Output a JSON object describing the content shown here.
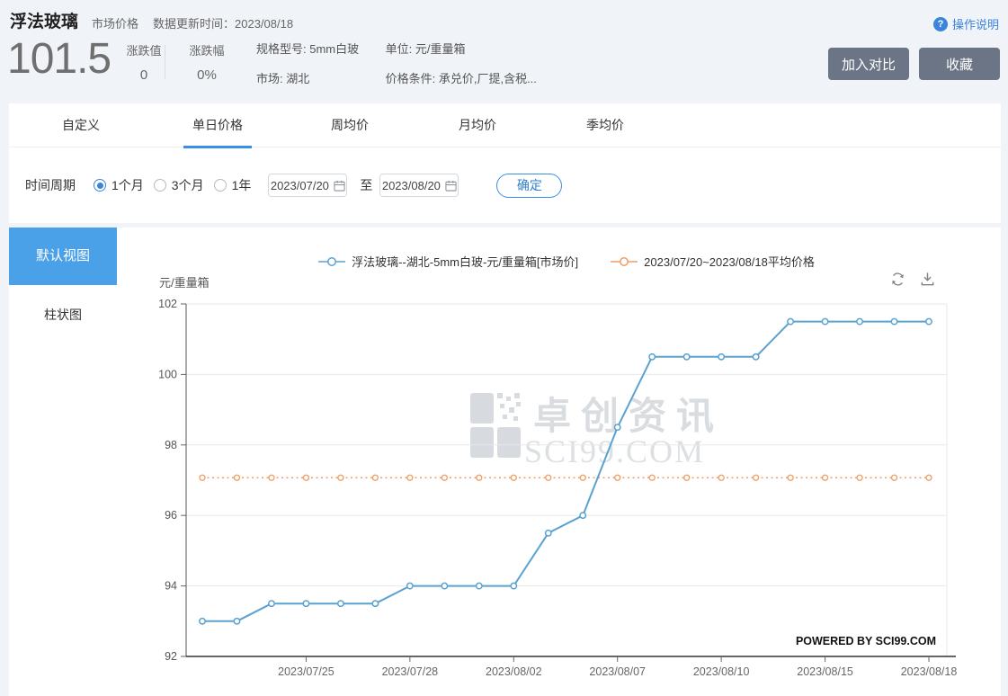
{
  "header": {
    "title": "浮法玻璃",
    "subtitle": "市场价格",
    "update_label": "数据更新时间：",
    "update_date": "2023/08/18",
    "help_label": "操作说明",
    "price": "101.5",
    "change_label": "涨跌值",
    "change_value": "0",
    "change_pct_label": "涨跌幅",
    "change_pct_value": "0%",
    "spec_label": "规格型号: 5mm白玻",
    "market_label": "市场: 湖北",
    "unit_label": "单位: 元/重量箱",
    "condition_label": "价格条件: 承兑价,厂提,含税...",
    "compare_button": "加入对比",
    "favorite_button": "收藏"
  },
  "tabs": [
    {
      "label": "自定义",
      "active": false
    },
    {
      "label": "单日价格",
      "active": true
    },
    {
      "label": "周均价",
      "active": false
    },
    {
      "label": "月均价",
      "active": false
    },
    {
      "label": "季均价",
      "active": false
    }
  ],
  "filter": {
    "period_label": "时间周期",
    "options": [
      {
        "label": "1个月",
        "selected": true
      },
      {
        "label": "3个月",
        "selected": false
      },
      {
        "label": "1年",
        "selected": false
      }
    ],
    "date_from": "2023/07/20",
    "to_label": "至",
    "date_to": "2023/08/20",
    "confirm_button": "确定"
  },
  "sidebar": {
    "items": [
      {
        "label": "默认视图",
        "active": true
      },
      {
        "label": "柱状图",
        "active": false
      }
    ]
  },
  "chart": {
    "watermark_cn": "卓创资讯",
    "watermark_en": "SCI99.COM",
    "powered_by": "POWERED BY SCI99.COM"
  },
  "colors": {
    "accent": "#3a84dc",
    "sidebar_active": "#4ba1e8",
    "header_button": "#6c7585",
    "grid": "#e8e8e8",
    "axis": "#4a4a4a"
  },
  "chart_data": {
    "type": "line",
    "title": "",
    "xlabel": "",
    "ylabel": "元/重量箱",
    "ylim": [
      92,
      102
    ],
    "ytick_step": 2,
    "grid": "horizontal-only",
    "legend_position": "top",
    "x": [
      "2023/07/20",
      "2023/07/21",
      "2023/07/24",
      "2023/07/25",
      "2023/07/26",
      "2023/07/27",
      "2023/07/28",
      "2023/07/31",
      "2023/08/01",
      "2023/08/02",
      "2023/08/03",
      "2023/08/04",
      "2023/08/07",
      "2023/08/08",
      "2023/08/09",
      "2023/08/10",
      "2023/08/11",
      "2023/08/14",
      "2023/08/15",
      "2023/08/16",
      "2023/08/17",
      "2023/08/18"
    ],
    "xtick_labels": [
      "2023/07/25",
      "2023/07/28",
      "2023/08/02",
      "2023/08/07",
      "2023/08/10",
      "2023/08/15",
      "2023/08/18"
    ],
    "series": [
      {
        "name": "浮法玻璃--湖北-5mm白玻-元/重量箱[市场价]",
        "color": "#5aa2d0",
        "style": "solid",
        "values": [
          93,
          93,
          93.5,
          93.5,
          93.5,
          93.5,
          94,
          94,
          94,
          94,
          95.5,
          96,
          98.5,
          100.5,
          100.5,
          100.5,
          100.5,
          101.5,
          101.5,
          101.5,
          101.5,
          101.5
        ]
      },
      {
        "name": "2023/07/20~2023/08/18平均价格",
        "color": "#ee9d63",
        "style": "dotted",
        "constant_value": 97.07
      }
    ]
  }
}
